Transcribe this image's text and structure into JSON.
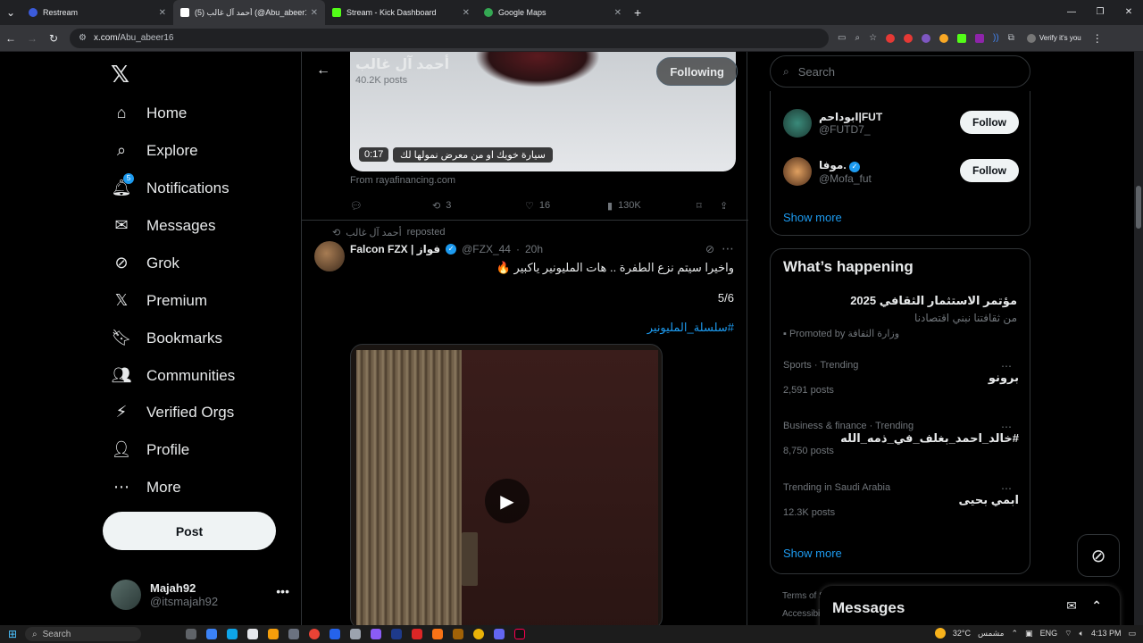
{
  "browser": {
    "tabs": [
      {
        "label": "Restream",
        "color": "#3b5bdb"
      },
      {
        "label": "(5) أحمد آل غالب (@Abu_abeer16",
        "color": "#ffffff"
      },
      {
        "label": "Stream - Kick Dashboard",
        "color": "#53fc18"
      },
      {
        "label": "Google Maps",
        "color": "#34a853"
      }
    ],
    "url_prefix": "x.com/",
    "url_path": "Abu_abeer16",
    "profile_label": "Verify it's you"
  },
  "sidebar": {
    "items": [
      {
        "label": "Home",
        "icon": "home-icon"
      },
      {
        "label": "Explore",
        "icon": "search-icon"
      },
      {
        "label": "Notifications",
        "icon": "bell-icon",
        "badge": "5"
      },
      {
        "label": "Messages",
        "icon": "envelope-icon"
      },
      {
        "label": "Grok",
        "icon": "grok-icon"
      },
      {
        "label": "Premium",
        "icon": "x-icon"
      },
      {
        "label": "Bookmarks",
        "icon": "bookmark-icon"
      },
      {
        "label": "Communities",
        "icon": "people-icon"
      },
      {
        "label": "Verified Orgs",
        "icon": "lightning-icon"
      },
      {
        "label": "Profile",
        "icon": "person-icon"
      },
      {
        "label": "More",
        "icon": "more-circle-icon"
      }
    ],
    "post_label": "Post",
    "account": {
      "name": "Majah92",
      "handle": "@itsmajah92"
    }
  },
  "profile_header": {
    "name": "أحمد آل غالب",
    "posts": "40.2K posts",
    "following_label": "Following"
  },
  "prev_post": {
    "duration": "0:17",
    "caption": "سيارة خويك او من معرض نمولها لك",
    "from": "From rayafinancing.com",
    "reposts": "3",
    "likes": "16",
    "views": "130K"
  },
  "post": {
    "repost_by": "أحمد آل غالب",
    "repost_word": "reposted",
    "author": "Falcon FZX | فواز",
    "handle": "@FZX_44",
    "time": "20h",
    "text": "واخيرا سيتم نزع الطفرة .. هات المليونير ياكبير 🔥",
    "count": "5/6",
    "hashtag": "#سلسلة_المليونير"
  },
  "search": {
    "placeholder": "Search"
  },
  "who_to_follow": [
    {
      "name": "ابوداحم|FUT",
      "handle": "@FUTD7_",
      "button": "Follow"
    },
    {
      "name": "موفا.",
      "handle": "@Mofa_fut",
      "button": "Follow"
    }
  ],
  "wtf_show_more": "Show more",
  "happening": {
    "title": "What’s happening",
    "promo_title": "مؤتمر الاستثمار الثقافي 2025",
    "promo_sub": "من ثقافتنا نبني اقتصادنا",
    "promo_by": "Promoted by وزارة الثقافة",
    "trends": [
      {
        "meta": "Sports · Trending",
        "name": "برونو",
        "count": "2,591 posts"
      },
      {
        "meta": "Business & finance · Trending",
        "name": "#خالد_احمد_بغلف_في_ذمه_الله",
        "count": "8,750 posts"
      },
      {
        "meta": "Trending in Saudi Arabia",
        "name": "ابمي بحيى",
        "count": "12.3K posts"
      }
    ],
    "show_more": "Show more"
  },
  "footer": {
    "line1": "Terms of S",
    "line2": "Accessibili"
  },
  "messages_dock": {
    "title": "Messages"
  },
  "taskbar": {
    "search": "Search",
    "weather": "32°C",
    "weather_desc": "مشمس",
    "lang": "ENG",
    "time": "4:13 PM"
  }
}
